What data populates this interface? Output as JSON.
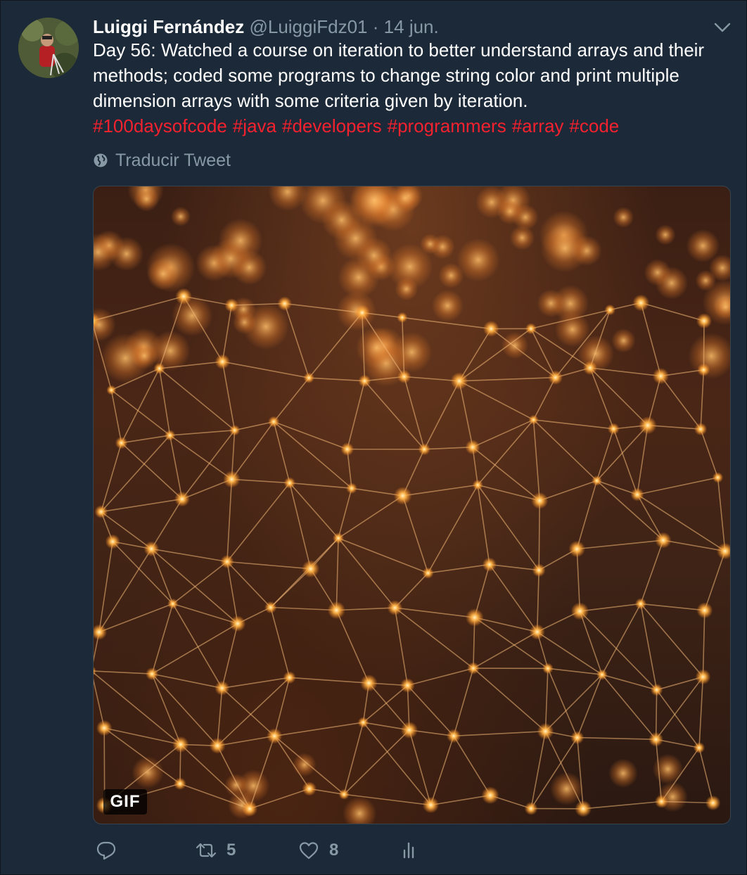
{
  "tweet": {
    "author_name": "Luiggi Fernández",
    "handle": "@LuiggiFdz01",
    "separator": "·",
    "date": "14 jun.",
    "text": "Day 56: Watched a course on iteration to better understand arrays and their methods; coded some programs to change string color and print multiple dimension arrays with some criteria given by iteration.",
    "hashtags": [
      "#100daysofcode",
      "#java",
      "#developers",
      "#programmers",
      "#array",
      "#code"
    ],
    "translate_label": "Traducir Tweet",
    "media_badge": "GIF"
  },
  "actions": {
    "reply_icon": "reply-icon",
    "retweet_icon": "retweet-icon",
    "retweet_count": "5",
    "like_icon": "heart-icon",
    "like_count": "8",
    "analytics_icon": "analytics-icon"
  },
  "colors": {
    "background": "#1c2938",
    "text": "#ffffff",
    "muted": "#8899a6",
    "hashtag": "#f4212e",
    "glow": "#ffb347"
  }
}
